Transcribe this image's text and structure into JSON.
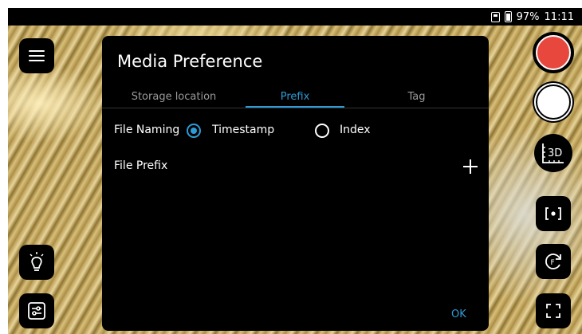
{
  "status_bar": {
    "battery": "97%",
    "time": "11:11"
  },
  "dialog": {
    "title": "Media Preference",
    "tabs": [
      {
        "label": "Storage location",
        "active": false
      },
      {
        "label": "Prefix",
        "active": true
      },
      {
        "label": "Tag",
        "active": false
      }
    ],
    "file_naming": {
      "label": "File Naming",
      "options": [
        {
          "label": "Timestamp",
          "selected": true
        },
        {
          "label": "Index",
          "selected": false
        }
      ]
    },
    "file_prefix": {
      "label": "File Prefix",
      "add_icon": "plus-icon"
    },
    "ok_label": "OK"
  },
  "left_controls": [
    "menu-icon",
    "light-bulb-icon",
    "settings-sliders-icon"
  ],
  "right_controls": {
    "record_color": "#e8473e",
    "shutter_color": "#ffffff",
    "measure_label": "3D",
    "icons": [
      "focus-icon",
      "autofocus-rotate-icon",
      "fullscreen-icon"
    ]
  },
  "colors": {
    "accent": "#2e9bd6",
    "record": "#e8473e"
  }
}
